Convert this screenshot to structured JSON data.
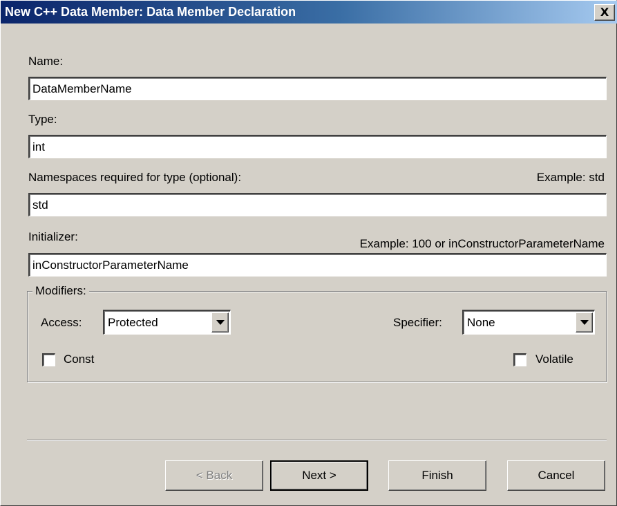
{
  "window": {
    "title": "New C++ Data Member: Data Member Declaration",
    "close_glyph": "X"
  },
  "fields": {
    "name": {
      "label": "Name:",
      "value": "DataMemberName"
    },
    "type": {
      "label": "Type:",
      "value": "int"
    },
    "namespaces": {
      "label": "Namespaces required for type (optional):",
      "example": "Example: std",
      "value": "std"
    },
    "initializer": {
      "label": "Initializer:",
      "example": "Example: 100 or inConstructorParameterName",
      "value": "inConstructorParameterName"
    }
  },
  "modifiers": {
    "title": "Modifiers:",
    "access": {
      "label": "Access:",
      "selected": "Protected"
    },
    "specifier": {
      "label": "Specifier:",
      "selected": "None"
    },
    "const": {
      "label": "Const",
      "checked": false
    },
    "volatile": {
      "label": "Volatile",
      "checked": false
    }
  },
  "buttons": {
    "back": {
      "label": "< Back",
      "enabled": false
    },
    "next": {
      "label": "Next >",
      "enabled": true
    },
    "finish": {
      "label": "Finish",
      "enabled": true
    },
    "cancel": {
      "label": "Cancel",
      "enabled": true
    }
  },
  "colors": {
    "titlebar_start": "#0a246a",
    "titlebar_end": "#a6caf0",
    "face": "#d4d0c8",
    "disabled_text": "#808080"
  }
}
